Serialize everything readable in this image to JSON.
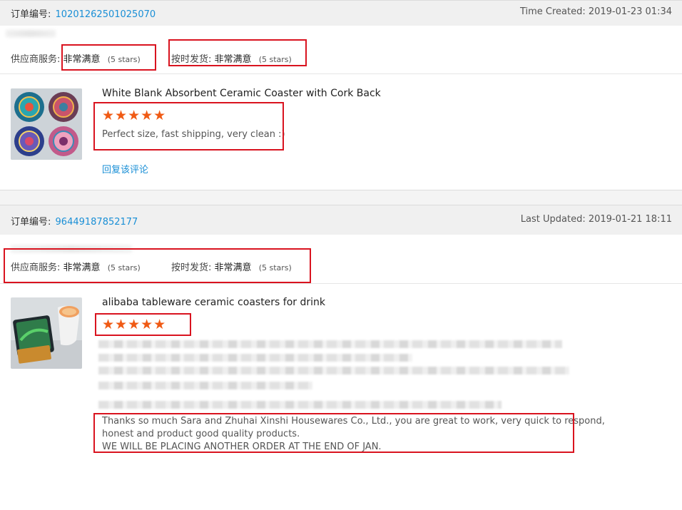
{
  "orders": [
    {
      "number_label": "订单编号:",
      "number": "10201262501025070",
      "time": "Time Created: 2019-01-23 01:34",
      "ratings": [
        {
          "label": "供应商服务:",
          "value": "非常满意",
          "stars": "(5 stars)"
        },
        {
          "label": "按时发货:",
          "value": "非常满意",
          "stars": "(5 stars)"
        }
      ],
      "product": {
        "title": "White Blank Absorbent Ceramic Coaster with Cork Back",
        "rating": 5,
        "stars_text": "★★★★★",
        "review": "Perfect size, fast shipping, very clean :)",
        "reply_link": "回复该评论"
      }
    },
    {
      "number_label": "订单编号:",
      "number": "96449187852177",
      "time": "Last Updated: 2019-01-21 18:11",
      "ratings": [
        {
          "label": "供应商服务:",
          "value": "非常满意",
          "stars": "(5 stars)"
        },
        {
          "label": "按时发货:",
          "value": "非常满意",
          "stars": "(5 stars)"
        }
      ],
      "product": {
        "title": "alibaba tableware ceramic coasters for drink",
        "rating": 5,
        "stars_text": "★★★★★",
        "review_lines": [
          "Thanks so much Sara and Zhuhai Xinshi Housewares Co., Ltd., you are great to work, very quick to respond,",
          "honest and product good quality products.",
          "WE WILL BE PLACING ANOTHER ORDER AT THE END OF JAN."
        ]
      }
    }
  ],
  "colors": {
    "accent_link": "#1a8fd6",
    "star": "#f05a14",
    "highlight_box": "#d9131f"
  },
  "icons": [
    "star-icon"
  ]
}
